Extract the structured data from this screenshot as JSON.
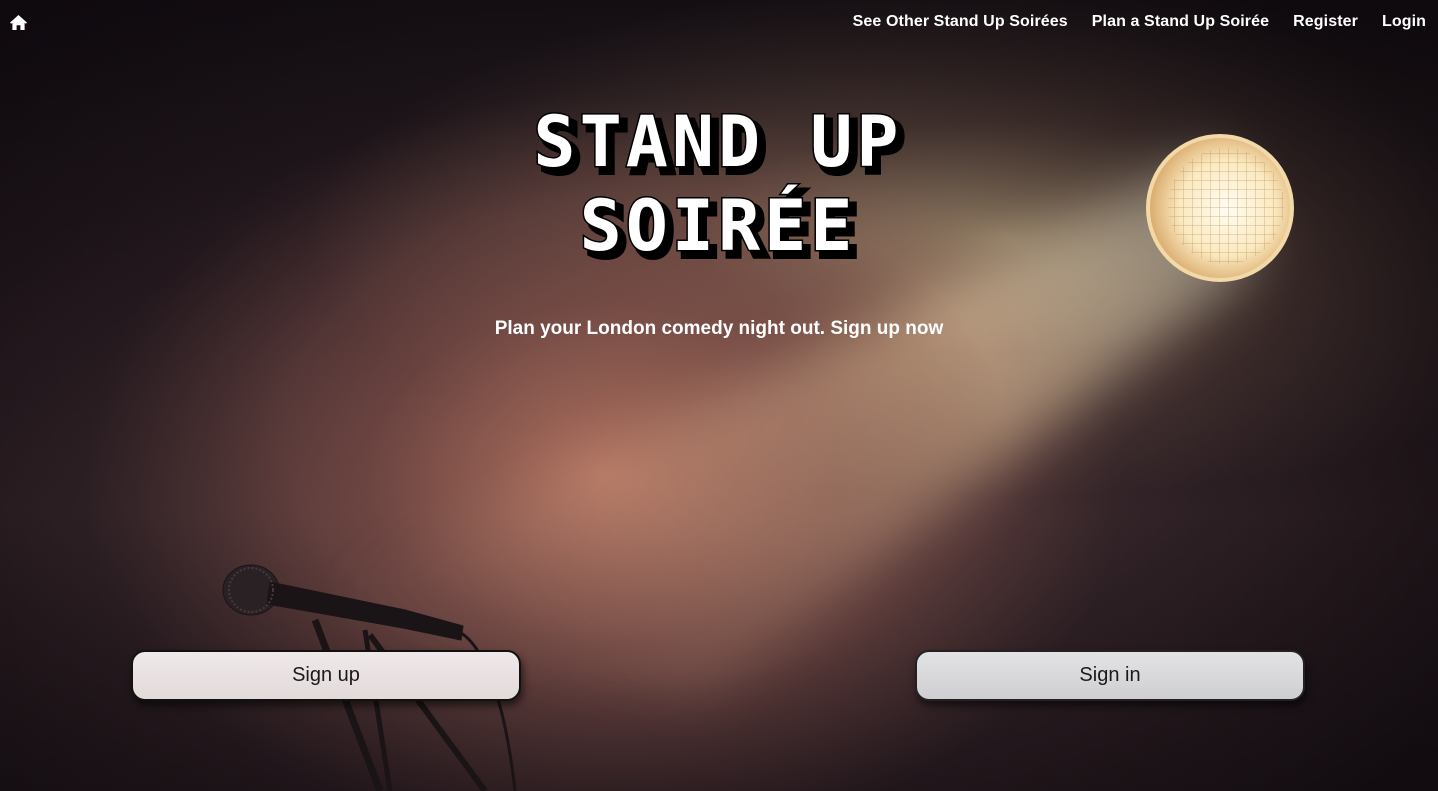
{
  "nav": {
    "home_icon": "home-icon",
    "links": [
      {
        "label": "See Other Stand Up Soirées"
      },
      {
        "label": "Plan a Stand Up Soirée"
      },
      {
        "label": "Register"
      },
      {
        "label": "Login"
      }
    ]
  },
  "hero": {
    "logo_line1": "STAND UP",
    "logo_line2": "SOIRÉE",
    "tagline": "Plan your London comedy night out.",
    "tagline_link": "Sign up now"
  },
  "buttons": {
    "signup": "Sign up",
    "signin": "Sign in"
  },
  "colors": {
    "nav_text": "#ffffff",
    "button_bg": "#e6e1e2",
    "button_border": "#111111"
  }
}
